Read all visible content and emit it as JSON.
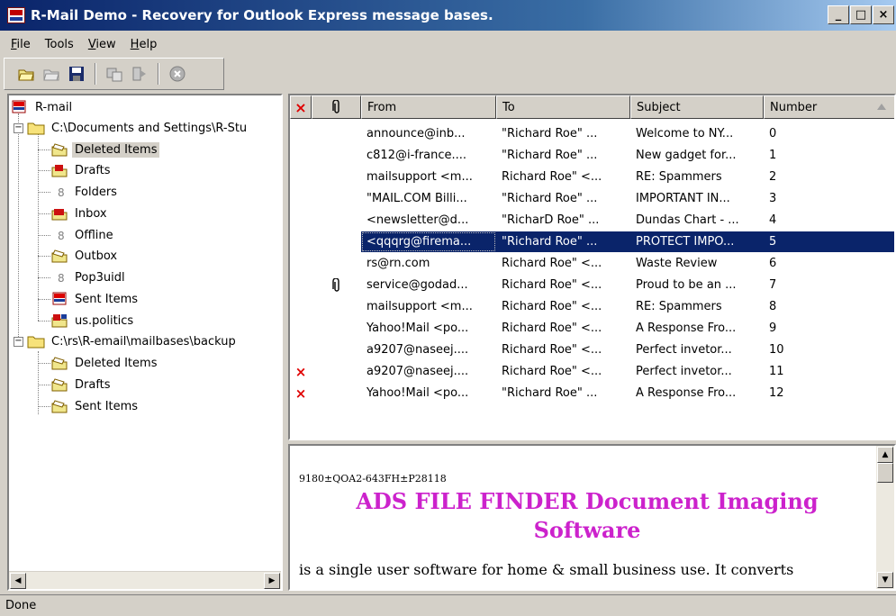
{
  "window": {
    "title": "R-Mail Demo - Recovery for Outlook Express message bases.",
    "minimize": "_",
    "maximize": "□",
    "close": "×"
  },
  "menu": [
    {
      "label": "File",
      "key": "F",
      "rest": "ile"
    },
    {
      "label": "Tools",
      "key": "T",
      "rest": "ools"
    },
    {
      "label": "View",
      "key": "V",
      "rest": "iew"
    },
    {
      "label": "Help",
      "key": "H",
      "rest": "elp"
    }
  ],
  "toolbar": {
    "icons": [
      "open-folder-icon",
      "open-folder-disabled-icon",
      "save-icon",
      "recover-icon",
      "export-icon",
      "stop-icon"
    ]
  },
  "tree": {
    "root": "R-mail",
    "groups": [
      {
        "path": "C:\\Documents and Settings\\R-Stu",
        "items": [
          "Deleted Items",
          "Drafts",
          "Folders",
          "Inbox",
          "Offline",
          "Outbox",
          "Pop3uidl",
          "Sent Items",
          "us.politics"
        ]
      },
      {
        "path": "C:\\rs\\R-email\\mailbases\\backup",
        "items": [
          "Deleted Items",
          "Drafts",
          "Sent Items"
        ]
      }
    ],
    "selected": "Deleted Items"
  },
  "list": {
    "columns": {
      "deleted": "×",
      "attachment": "📎",
      "from": "From",
      "to": "To",
      "subject": "Subject",
      "number": "Number"
    },
    "rows": [
      {
        "deleted": false,
        "attachment": false,
        "from": "announce@inb...",
        "to": "\"Richard Roe\" ...",
        "subject": "Welcome to NY...",
        "number": "0"
      },
      {
        "deleted": false,
        "attachment": false,
        "from": "c812@i-france....",
        "to": "\"Richard Roe\" ...",
        "subject": "New gadget for...",
        "number": "1"
      },
      {
        "deleted": false,
        "attachment": false,
        "from": "mailsupport <m...",
        "to": "Richard Roe\" <...",
        "subject": "RE: Spammers",
        "number": "2"
      },
      {
        "deleted": false,
        "attachment": false,
        "from": "\"MAIL.COM Billi...",
        "to": "\"Richard Roe\" ...",
        "subject": "IMPORTANT IN...",
        "number": "3"
      },
      {
        "deleted": false,
        "attachment": false,
        "from": "<newsletter@d...",
        "to": "\"RicharD Roe\" ...",
        "subject": "Dundas Chart - ...",
        "number": "4"
      },
      {
        "deleted": false,
        "attachment": false,
        "from": "<qqqrg@firema...",
        "to": "\"Richard Roe\" ...",
        "subject": "PROTECT IMPO...",
        "number": "5"
      },
      {
        "deleted": false,
        "attachment": false,
        "from": "rs@rn.com",
        "to": "Richard Roe\" <...",
        "subject": "Waste Review",
        "number": "6"
      },
      {
        "deleted": false,
        "attachment": true,
        "from": "service@godad...",
        "to": "Richard Roe\" <...",
        "subject": "Proud to be an ...",
        "number": "7"
      },
      {
        "deleted": false,
        "attachment": false,
        "from": "mailsupport <m...",
        "to": "Richard Roe\" <...",
        "subject": "RE: Spammers",
        "number": "8"
      },
      {
        "deleted": false,
        "attachment": false,
        "from": "Yahoo!Mail <po...",
        "to": "Richard Roe\" <...",
        "subject": "A Response Fro...",
        "number": "9"
      },
      {
        "deleted": false,
        "attachment": false,
        "from": "a9207@naseej....",
        "to": "Richard Roe\" <...",
        "subject": "Perfect invetor...",
        "number": "10"
      },
      {
        "deleted": true,
        "attachment": false,
        "from": "a9207@naseej....",
        "to": "Richard Roe\" <...",
        "subject": "Perfect invetor...",
        "number": "11"
      },
      {
        "deleted": true,
        "attachment": false,
        "from": "Yahoo!Mail <po...",
        "to": "\"Richard Roe\" ...",
        "subject": "A Response Fro...",
        "number": "12"
      }
    ],
    "selected_index": 5
  },
  "preview": {
    "id_line": "9180±QOA2-643FH±P28118",
    "title": "ADS FILE FINDER Document Imaging Software",
    "body": "is a single user software for home & small business use. It converts",
    "title_color": "#cc22cc"
  },
  "status": {
    "text": "Done"
  },
  "colors": {
    "selection": "#0a246a",
    "deleted_mark": "#e00000",
    "chrome": "#d4d0c8"
  }
}
